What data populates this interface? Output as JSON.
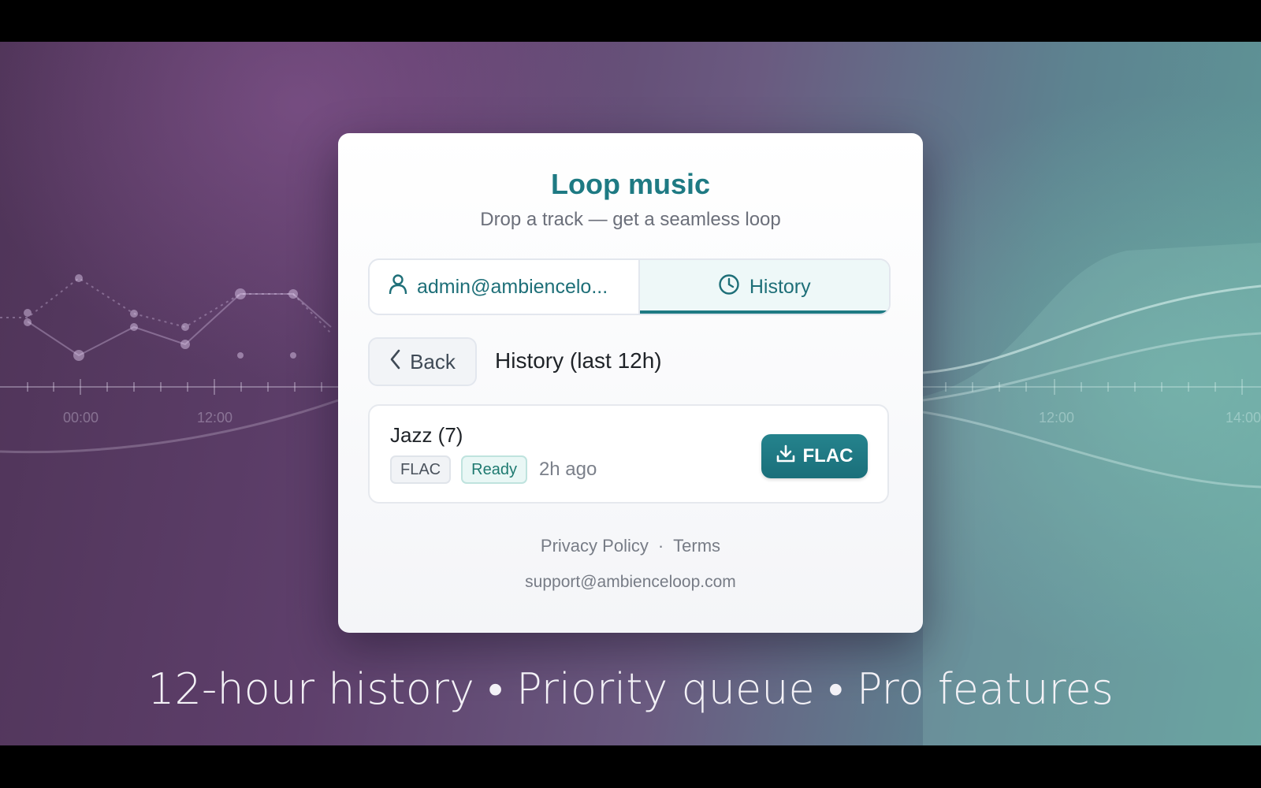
{
  "card": {
    "title": "Loop music",
    "subtitle": "Drop a track — get a seamless loop"
  },
  "tabs": {
    "account_label": "admin@ambiencelo...",
    "account_icon": "user-icon",
    "history_label": "History",
    "history_icon": "clock-icon",
    "active": "history"
  },
  "nav": {
    "back_label": "Back",
    "section_title": "History (last 12h)"
  },
  "history_items": [
    {
      "name": "Jazz (7)",
      "format": "FLAC",
      "status": "Ready",
      "age": "2h ago",
      "download_label": "FLAC",
      "download_icon": "download-icon"
    }
  ],
  "footer": {
    "privacy_label": "Privacy Policy",
    "separator": "·",
    "terms_label": "Terms",
    "email": "support@ambienceloop.com"
  },
  "background": {
    "timeline_labels": [
      "00:00",
      "12:00",
      "12:00",
      "14:00"
    ]
  },
  "caption": "12-hour history • Priority queue • Pro features",
  "colors": {
    "accent": "#1e7a83",
    "button": "#1a6f7a",
    "status_ready": "#1e7a70"
  }
}
